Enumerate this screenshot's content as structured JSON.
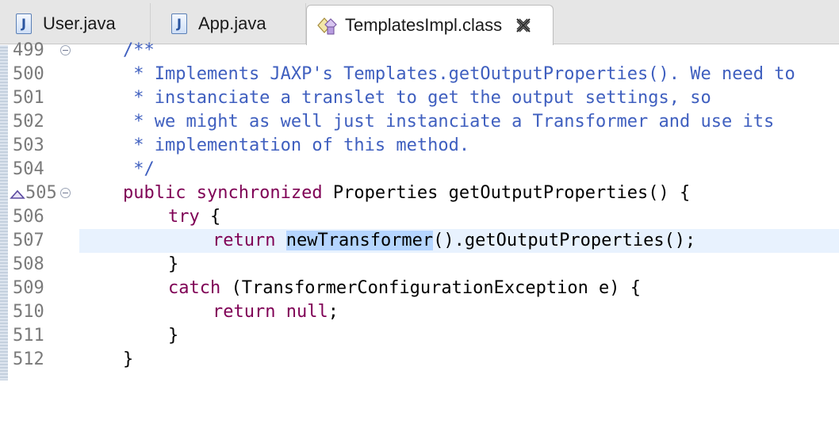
{
  "tabs": [
    {
      "label": "User.java",
      "icon": "java-file-icon"
    },
    {
      "label": "App.java",
      "icon": "java-file-icon"
    },
    {
      "label": "TemplatesImpl.class",
      "icon": "class-file-icon",
      "active": true
    }
  ],
  "editor": {
    "current_line": "507",
    "highlighted_token": "newTransformer",
    "lines": [
      {
        "num": "499",
        "text": "/**"
      },
      {
        "num": "500",
        "text": " * Implements JAXP's Templates.getOutputProperties(). We need to"
      },
      {
        "num": "501",
        "text": " * instanciate a translet to get the output settings, so"
      },
      {
        "num": "502",
        "text": " * we might as well just instanciate a Transformer and use its"
      },
      {
        "num": "503",
        "text": " * implementation of this method."
      },
      {
        "num": "504",
        "text": " */"
      },
      {
        "num": "505",
        "kw": "public synchronized",
        "rest": " Properties getOutputProperties() {"
      },
      {
        "num": "506",
        "kw": "try",
        "rest": " {"
      },
      {
        "num": "507",
        "kw": "return",
        "token": "newTransformer",
        "rest": "().getOutputProperties();"
      },
      {
        "num": "508",
        "rest": "}"
      },
      {
        "num": "509",
        "kw": "catch",
        "rest": " (TransformerConfigurationException e) {"
      },
      {
        "num": "510",
        "kw": "return",
        "kw2": "null",
        "rest": ";"
      },
      {
        "num": "511",
        "rest": "}"
      },
      {
        "num": "512",
        "rest": "}"
      }
    ]
  },
  "colors": {
    "javadoc": "#3f5fbf",
    "keyword": "#7f0055",
    "current_line_bg": "#e8f2fe",
    "selection_bg": "#b5d5ff"
  }
}
